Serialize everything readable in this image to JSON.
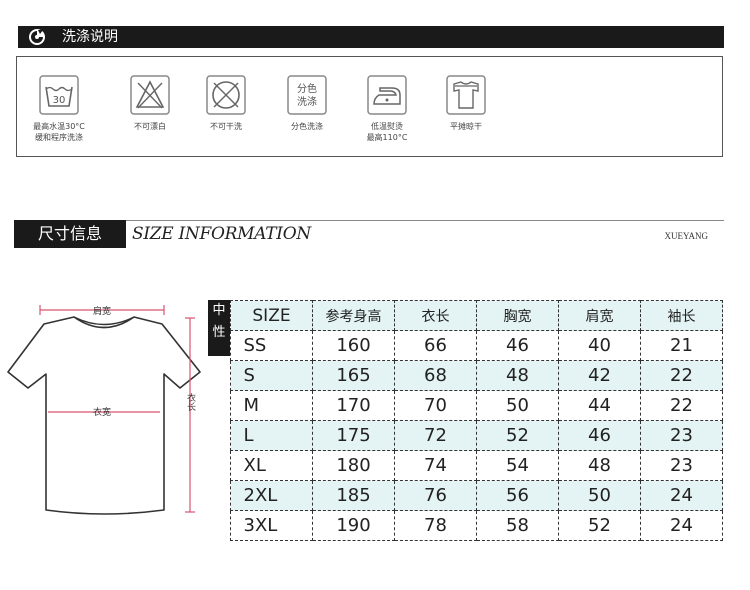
{
  "care": {
    "title": "洗涤说明",
    "items": [
      {
        "icon": "wash-30-icon",
        "badge": "30",
        "line1": "最高水温30°C",
        "line2": "缓和程序洗涤"
      },
      {
        "icon": "no-bleach-icon",
        "line1": "不可漂白",
        "line2": ""
      },
      {
        "icon": "no-dry-clean-icon",
        "line1": "不可干洗",
        "line2": ""
      },
      {
        "icon": "wash-separately-icon",
        "badge_line1": "分色",
        "badge_line2": "洗涤",
        "line1": "分色洗涤",
        "line2": ""
      },
      {
        "icon": "low-iron-icon",
        "line1": "低温熨烫",
        "line2": "最高110°C"
      },
      {
        "icon": "dry-flat-icon",
        "line1": "平摊晾干",
        "line2": ""
      }
    ]
  },
  "size_info": {
    "title_cn": "尺寸信息",
    "title_en": "SIZE INFORMATION",
    "brand": "XUEYANG"
  },
  "diagram": {
    "shoulder_label": "肩宽",
    "chest_label": "衣宽",
    "length_label": "衣长"
  },
  "table": {
    "gender_label_1": "中",
    "gender_label_2": "性",
    "headers": [
      "SIZE",
      "参考身高",
      "衣长",
      "胸宽",
      "肩宽",
      "袖长"
    ],
    "rows": [
      [
        "SS",
        "160",
        "66",
        "46",
        "40",
        "21"
      ],
      [
        "S",
        "165",
        "68",
        "48",
        "42",
        "22"
      ],
      [
        "M",
        "170",
        "70",
        "50",
        "44",
        "22"
      ],
      [
        "L",
        "175",
        "72",
        "52",
        "46",
        "23"
      ],
      [
        "XL",
        "180",
        "74",
        "54",
        "48",
        "23"
      ],
      [
        "2XL",
        "185",
        "76",
        "56",
        "50",
        "24"
      ],
      [
        "3XL",
        "190",
        "78",
        "58",
        "52",
        "24"
      ]
    ]
  },
  "colors": {
    "header_bg": "#1a1a1a",
    "table_shade": "#e4f3f4",
    "measure_line": "#d9536f"
  }
}
